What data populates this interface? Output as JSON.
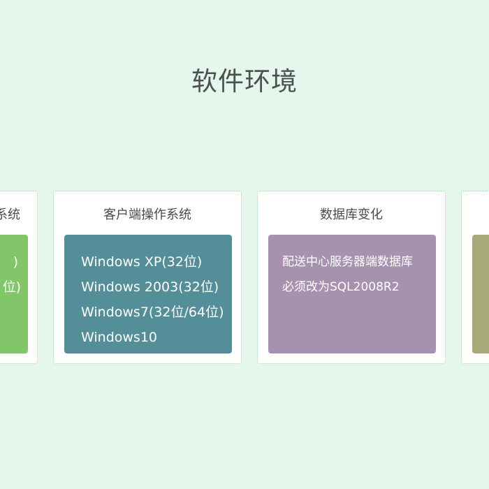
{
  "page": {
    "title": "软件环境"
  },
  "cards": [
    {
      "title": "系统",
      "color": "#82c66a",
      "lines": [
        ")",
        "位)"
      ]
    },
    {
      "title": "客户端操作系统",
      "color": "#548f99",
      "lines": [
        "Windows XP(32位)",
        "Windows 2003(32位)",
        "Windows7(32位/64位)",
        "Windows10"
      ]
    },
    {
      "title": "数据库变化",
      "color": "#a891ae",
      "lines": [
        "配送中心服务器端数据库",
        "必须改为SQL2008R2"
      ]
    },
    {
      "title": "",
      "color": "#a7a978",
      "lines": []
    }
  ]
}
